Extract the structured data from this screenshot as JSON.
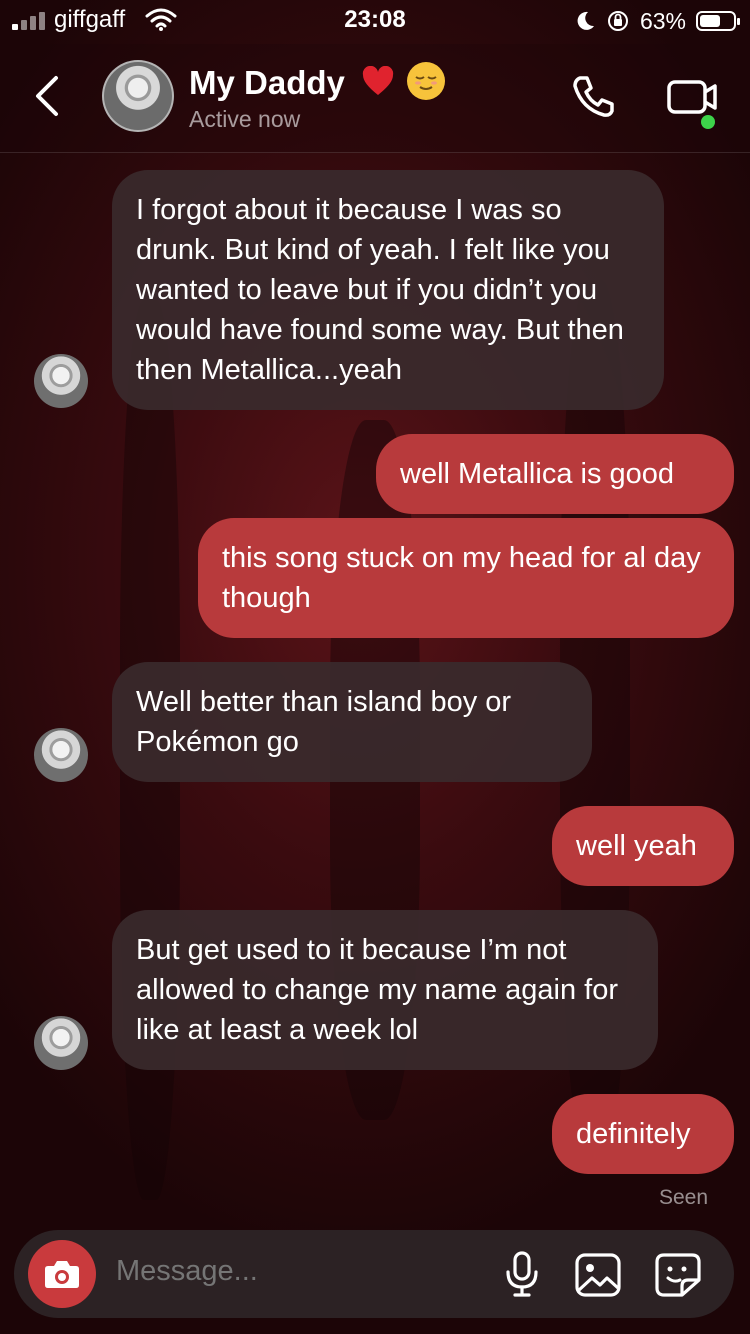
{
  "status_bar": {
    "carrier": "giffgaff",
    "time": "23:08",
    "battery_percent": "63%",
    "battery_level": 0.63
  },
  "header": {
    "contact_name": "My Daddy",
    "status": "Active now"
  },
  "messages": [
    {
      "direction": "in",
      "text": "I forgot about it because I was so drunk. But kind of yeah. I felt like you wanted to leave but if you didn’t you would have found some way. But then then Metallica...yeah"
    },
    {
      "direction": "out",
      "text": "well Metallica is good"
    },
    {
      "direction": "out",
      "text": "this song stuck on my head for al day though"
    },
    {
      "direction": "in",
      "text": "Well better than island boy or Pokémon go"
    },
    {
      "direction": "out",
      "text": "well yeah"
    },
    {
      "direction": "in",
      "text": "But get used to it because I’m not allowed to change my name again for like at least a week lol"
    },
    {
      "direction": "out",
      "text": "definitely"
    }
  ],
  "seen_label": "Seen",
  "composer": {
    "placeholder": "Message..."
  },
  "colors": {
    "outgoing_bubble": "#b83a3c",
    "incoming_bubble": "#3a2a2c",
    "camera_button": "#c93a3d",
    "online_dot": "#3dd34a"
  },
  "icons": [
    "back-chevron-icon",
    "phone-icon",
    "video-call-icon",
    "camera-icon",
    "microphone-icon",
    "gallery-icon",
    "sticker-icon",
    "red-heart-emoji",
    "relieved-face-emoji"
  ]
}
